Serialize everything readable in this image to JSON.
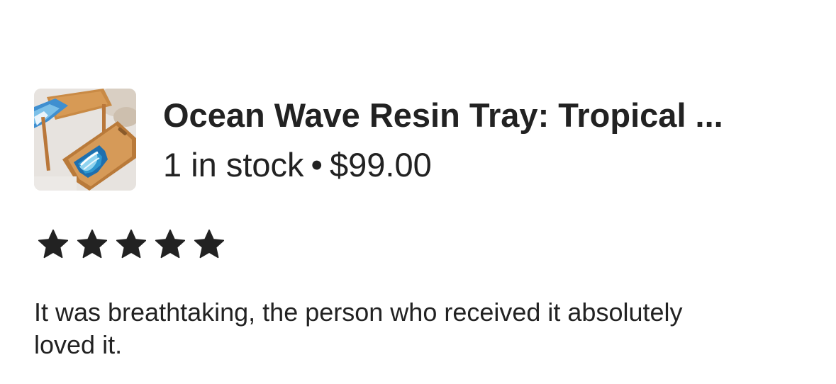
{
  "listing": {
    "thumbnail_icon": "ocean-wave-resin-tray-photo",
    "title": "Ocean Wave Resin Tray: Tropical ...",
    "stock": "1 in stock",
    "separator": "•",
    "price": "$99.00"
  },
  "review": {
    "rating": 5,
    "rating_max": 5,
    "star_icon": "star-filled-icon",
    "text": "It was breathtaking, the person who received it absolutely loved it."
  },
  "colors": {
    "text": "#222222",
    "star": "#222222",
    "background": "#ffffff",
    "wood": "#c98a45",
    "resin_blue": "#2f8fc9"
  }
}
